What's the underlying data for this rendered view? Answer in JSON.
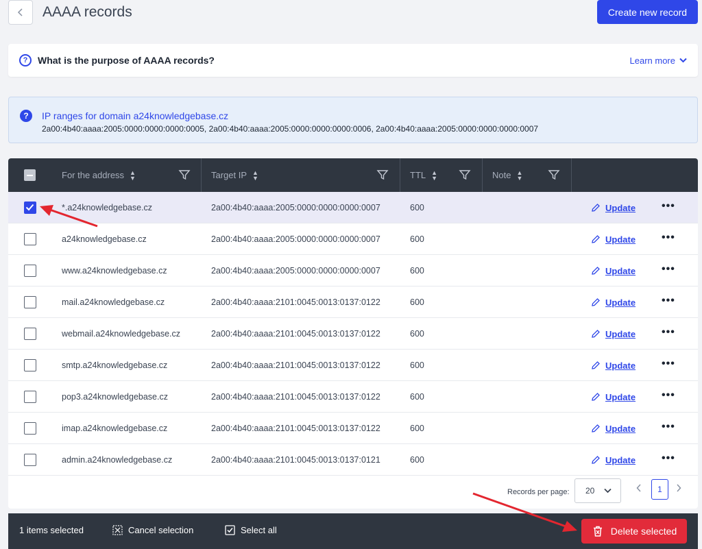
{
  "header": {
    "title": "AAAA records",
    "create_label": "Create new record"
  },
  "faq": {
    "question": "What is the purpose of AAAA records?",
    "learn_more": "Learn more"
  },
  "info": {
    "title": "IP ranges for domain a24knowledgebase.cz",
    "ranges": "2a00:4b40:aaaa:2005:0000:0000:0000:0005, 2a00:4b40:aaaa:2005:0000:0000:0000:0006, 2a00:4b40:aaaa:2005:0000:0000:0000:0007"
  },
  "table": {
    "columns": {
      "address": "For the address",
      "target": "Target IP",
      "ttl": "TTL",
      "note": "Note"
    },
    "update_label": "Update",
    "rows": [
      {
        "address": "*.a24knowledgebase.cz",
        "target": "2a00:4b40:aaaa:2005:0000:0000:0000:0007",
        "ttl": "600",
        "note": "",
        "selected": true
      },
      {
        "address": "a24knowledgebase.cz",
        "target": "2a00:4b40:aaaa:2005:0000:0000:0000:0007",
        "ttl": "600",
        "note": "",
        "selected": false
      },
      {
        "address": "www.a24knowledgebase.cz",
        "target": "2a00:4b40:aaaa:2005:0000:0000:0000:0007",
        "ttl": "600",
        "note": "",
        "selected": false
      },
      {
        "address": "mail.a24knowledgebase.cz",
        "target": "2a00:4b40:aaaa:2101:0045:0013:0137:0122",
        "ttl": "600",
        "note": "",
        "selected": false
      },
      {
        "address": "webmail.a24knowledgebase.cz",
        "target": "2a00:4b40:aaaa:2101:0045:0013:0137:0122",
        "ttl": "600",
        "note": "",
        "selected": false
      },
      {
        "address": "smtp.a24knowledgebase.cz",
        "target": "2a00:4b40:aaaa:2101:0045:0013:0137:0122",
        "ttl": "600",
        "note": "",
        "selected": false
      },
      {
        "address": "pop3.a24knowledgebase.cz",
        "target": "2a00:4b40:aaaa:2101:0045:0013:0137:0122",
        "ttl": "600",
        "note": "",
        "selected": false
      },
      {
        "address": "imap.a24knowledgebase.cz",
        "target": "2a00:4b40:aaaa:2101:0045:0013:0137:0122",
        "ttl": "600",
        "note": "",
        "selected": false
      },
      {
        "address": "admin.a24knowledgebase.cz",
        "target": "2a00:4b40:aaaa:2101:0045:0013:0137:0121",
        "ttl": "600",
        "note": "",
        "selected": false
      }
    ]
  },
  "pagination": {
    "records_per_page_label": "Records per page:",
    "records_per_page": "20",
    "current_page": "1"
  },
  "bottom_bar": {
    "selected_count": "1 items selected",
    "cancel_label": "Cancel selection",
    "select_all_label": "Select all",
    "delete_label": "Delete selected"
  },
  "colors": {
    "accent": "#2f47e8",
    "danger": "#e22b3a",
    "dark": "#2f3640",
    "annotation": "#e3262f"
  }
}
